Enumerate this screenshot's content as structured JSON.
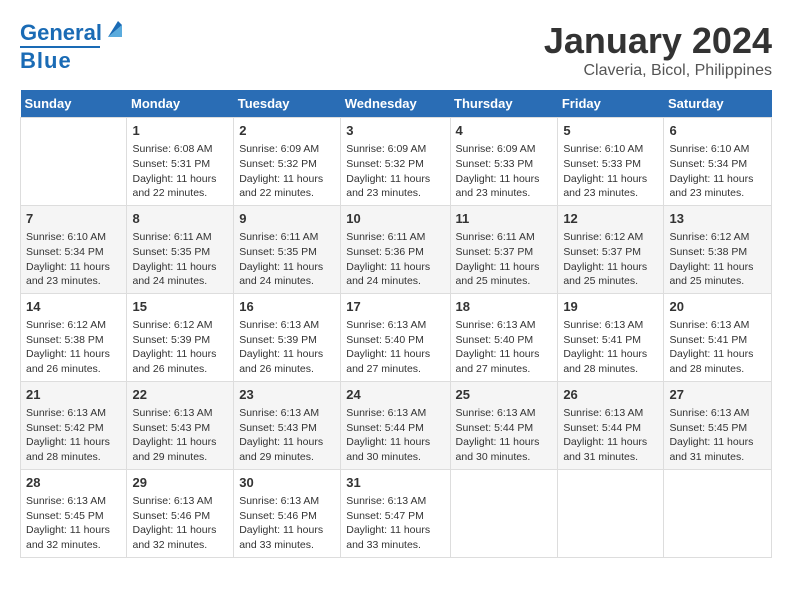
{
  "header": {
    "logo_general": "General",
    "logo_blue": "Blue",
    "title": "January 2024",
    "subtitle": "Claveria, Bicol, Philippines"
  },
  "columns": [
    "Sunday",
    "Monday",
    "Tuesday",
    "Wednesday",
    "Thursday",
    "Friday",
    "Saturday"
  ],
  "weeks": [
    [
      {
        "day": "",
        "info": ""
      },
      {
        "day": "1",
        "info": "Sunrise: 6:08 AM\nSunset: 5:31 PM\nDaylight: 11 hours\nand 22 minutes."
      },
      {
        "day": "2",
        "info": "Sunrise: 6:09 AM\nSunset: 5:32 PM\nDaylight: 11 hours\nand 22 minutes."
      },
      {
        "day": "3",
        "info": "Sunrise: 6:09 AM\nSunset: 5:32 PM\nDaylight: 11 hours\nand 23 minutes."
      },
      {
        "day": "4",
        "info": "Sunrise: 6:09 AM\nSunset: 5:33 PM\nDaylight: 11 hours\nand 23 minutes."
      },
      {
        "day": "5",
        "info": "Sunrise: 6:10 AM\nSunset: 5:33 PM\nDaylight: 11 hours\nand 23 minutes."
      },
      {
        "day": "6",
        "info": "Sunrise: 6:10 AM\nSunset: 5:34 PM\nDaylight: 11 hours\nand 23 minutes."
      }
    ],
    [
      {
        "day": "7",
        "info": "Sunrise: 6:10 AM\nSunset: 5:34 PM\nDaylight: 11 hours\nand 23 minutes."
      },
      {
        "day": "8",
        "info": "Sunrise: 6:11 AM\nSunset: 5:35 PM\nDaylight: 11 hours\nand 24 minutes."
      },
      {
        "day": "9",
        "info": "Sunrise: 6:11 AM\nSunset: 5:35 PM\nDaylight: 11 hours\nand 24 minutes."
      },
      {
        "day": "10",
        "info": "Sunrise: 6:11 AM\nSunset: 5:36 PM\nDaylight: 11 hours\nand 24 minutes."
      },
      {
        "day": "11",
        "info": "Sunrise: 6:11 AM\nSunset: 5:37 PM\nDaylight: 11 hours\nand 25 minutes."
      },
      {
        "day": "12",
        "info": "Sunrise: 6:12 AM\nSunset: 5:37 PM\nDaylight: 11 hours\nand 25 minutes."
      },
      {
        "day": "13",
        "info": "Sunrise: 6:12 AM\nSunset: 5:38 PM\nDaylight: 11 hours\nand 25 minutes."
      }
    ],
    [
      {
        "day": "14",
        "info": "Sunrise: 6:12 AM\nSunset: 5:38 PM\nDaylight: 11 hours\nand 26 minutes."
      },
      {
        "day": "15",
        "info": "Sunrise: 6:12 AM\nSunset: 5:39 PM\nDaylight: 11 hours\nand 26 minutes."
      },
      {
        "day": "16",
        "info": "Sunrise: 6:13 AM\nSunset: 5:39 PM\nDaylight: 11 hours\nand 26 minutes."
      },
      {
        "day": "17",
        "info": "Sunrise: 6:13 AM\nSunset: 5:40 PM\nDaylight: 11 hours\nand 27 minutes."
      },
      {
        "day": "18",
        "info": "Sunrise: 6:13 AM\nSunset: 5:40 PM\nDaylight: 11 hours\nand 27 minutes."
      },
      {
        "day": "19",
        "info": "Sunrise: 6:13 AM\nSunset: 5:41 PM\nDaylight: 11 hours\nand 28 minutes."
      },
      {
        "day": "20",
        "info": "Sunrise: 6:13 AM\nSunset: 5:41 PM\nDaylight: 11 hours\nand 28 minutes."
      }
    ],
    [
      {
        "day": "21",
        "info": "Sunrise: 6:13 AM\nSunset: 5:42 PM\nDaylight: 11 hours\nand 28 minutes."
      },
      {
        "day": "22",
        "info": "Sunrise: 6:13 AM\nSunset: 5:43 PM\nDaylight: 11 hours\nand 29 minutes."
      },
      {
        "day": "23",
        "info": "Sunrise: 6:13 AM\nSunset: 5:43 PM\nDaylight: 11 hours\nand 29 minutes."
      },
      {
        "day": "24",
        "info": "Sunrise: 6:13 AM\nSunset: 5:44 PM\nDaylight: 11 hours\nand 30 minutes."
      },
      {
        "day": "25",
        "info": "Sunrise: 6:13 AM\nSunset: 5:44 PM\nDaylight: 11 hours\nand 30 minutes."
      },
      {
        "day": "26",
        "info": "Sunrise: 6:13 AM\nSunset: 5:44 PM\nDaylight: 11 hours\nand 31 minutes."
      },
      {
        "day": "27",
        "info": "Sunrise: 6:13 AM\nSunset: 5:45 PM\nDaylight: 11 hours\nand 31 minutes."
      }
    ],
    [
      {
        "day": "28",
        "info": "Sunrise: 6:13 AM\nSunset: 5:45 PM\nDaylight: 11 hours\nand 32 minutes."
      },
      {
        "day": "29",
        "info": "Sunrise: 6:13 AM\nSunset: 5:46 PM\nDaylight: 11 hours\nand 32 minutes."
      },
      {
        "day": "30",
        "info": "Sunrise: 6:13 AM\nSunset: 5:46 PM\nDaylight: 11 hours\nand 33 minutes."
      },
      {
        "day": "31",
        "info": "Sunrise: 6:13 AM\nSunset: 5:47 PM\nDaylight: 11 hours\nand 33 minutes."
      },
      {
        "day": "",
        "info": ""
      },
      {
        "day": "",
        "info": ""
      },
      {
        "day": "",
        "info": ""
      }
    ]
  ]
}
